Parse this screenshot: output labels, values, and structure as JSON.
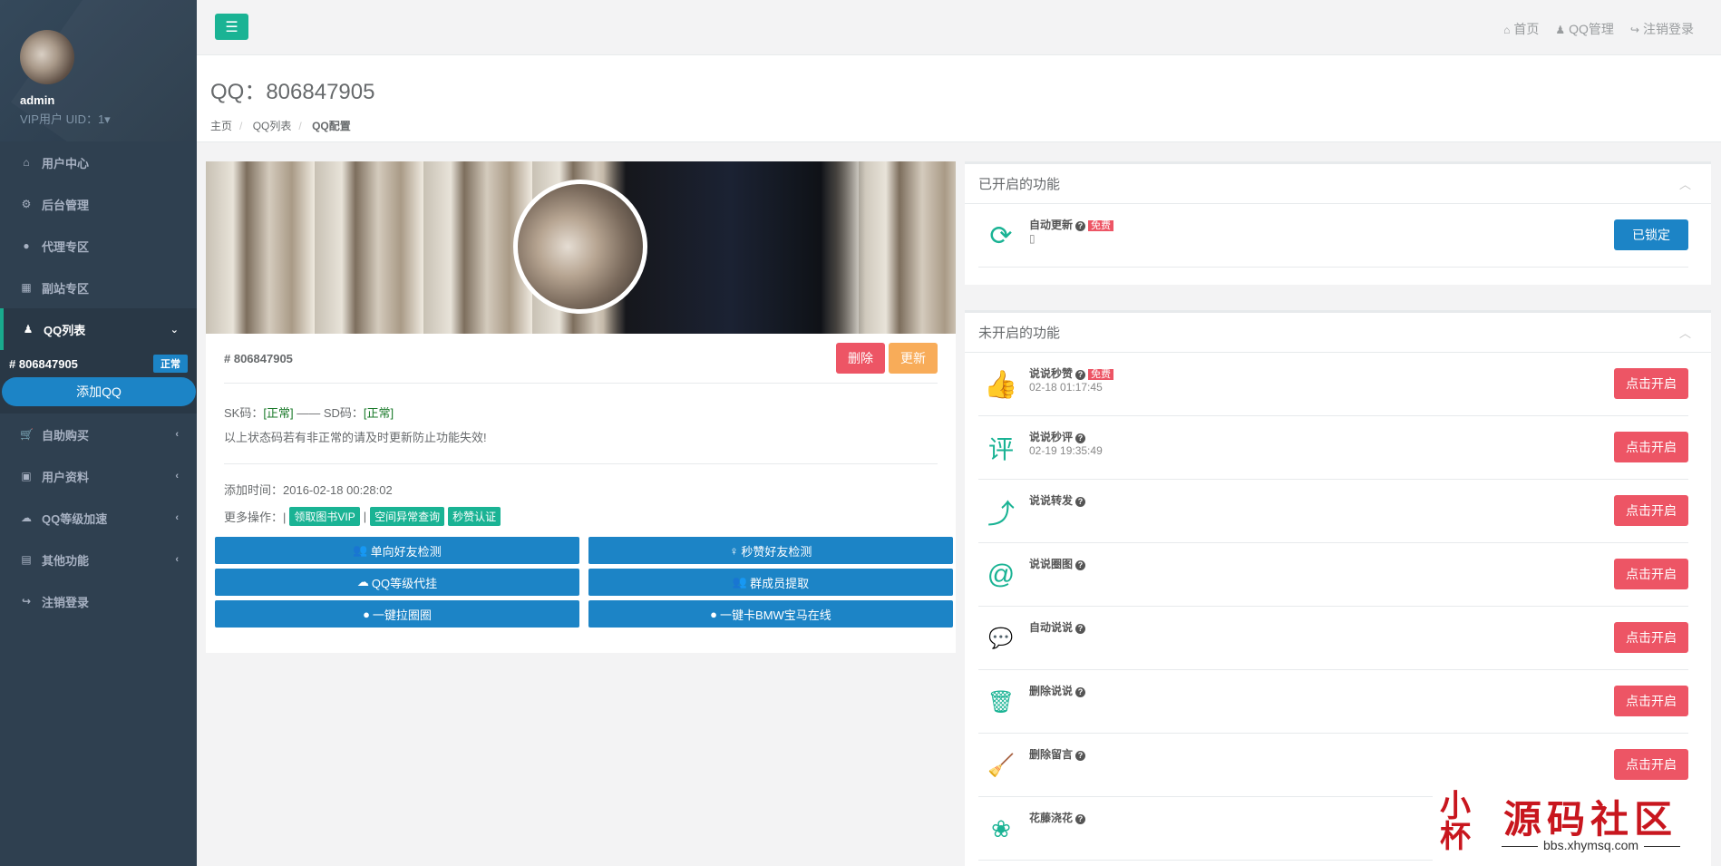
{
  "sidebar": {
    "user_name": "admin",
    "user_role": "VIP用户 UID：1▾",
    "menu": [
      {
        "label": "用户中心",
        "icon": "home-icon"
      },
      {
        "label": "后台管理",
        "icon": "gear-icon"
      },
      {
        "label": "代理专区",
        "icon": "globe-icon"
      },
      {
        "label": "副站专区",
        "icon": "grid-icon"
      },
      {
        "label": "QQ列表",
        "icon": "qq-icon"
      },
      {
        "label": "自助购买",
        "icon": "cart-icon"
      },
      {
        "label": "用户资料",
        "icon": "gift-icon"
      },
      {
        "label": "QQ等级加速",
        "icon": "cloud-icon"
      },
      {
        "label": "其他功能",
        "icon": "briefcase-icon"
      },
      {
        "label": "注销登录",
        "icon": "logout-icon"
      }
    ],
    "qq_sub": {
      "id": "# 806847905",
      "status": "正常",
      "add_label": "添加QQ"
    }
  },
  "topbar": {
    "links": [
      "首页",
      "QQ管理",
      "注销登录"
    ]
  },
  "header": {
    "title": "QQ：806847905",
    "breadcrumb": [
      "主页",
      "QQ列表",
      "QQ配置"
    ]
  },
  "profile": {
    "id": "# 806847905",
    "delete_label": "删除",
    "update_label": "更新",
    "sk_label": "SK码：",
    "sk_status": "[正常]",
    "dash": "—— SD码：",
    "sd_status": "[正常]",
    "note": "以上状态码若有非正常的请及时更新防止功能失效!",
    "add_time": "添加时间：2016-02-18 00:28:02",
    "more_label": "更多操作：|",
    "tags": [
      "领取图书VIP",
      "空间异常查询",
      "秒赞认证"
    ],
    "tag_sep": "|",
    "actions": [
      "单向好友检测",
      "秒赞好友检测",
      "QQ等级代挂",
      "群成员提取",
      "一键拉圈圈",
      "一键卡BMW宝马在线"
    ]
  },
  "enabled": {
    "title": "已开启的功能",
    "items": [
      {
        "name": "自动更新",
        "free": "免费",
        "time": "▯",
        "button": "已锁定",
        "icon": "refresh-icon"
      }
    ]
  },
  "disabled": {
    "title": "未开启的功能",
    "items": [
      {
        "name": "说说秒赞",
        "free": "免费",
        "time": "02-18 01:17:45",
        "button": "点击开启",
        "icon": "thumbs-up-icon"
      },
      {
        "name": "说说秒评",
        "free": "",
        "time": "02-19 19:35:49",
        "button": "点击开启",
        "icon": "comment-char-icon"
      },
      {
        "name": "说说转发",
        "free": "",
        "time": "",
        "button": "点击开启",
        "icon": "share-icon"
      },
      {
        "name": "说说圈图",
        "free": "",
        "time": "",
        "button": "点击开启",
        "icon": "at-icon"
      },
      {
        "name": "自动说说",
        "free": "",
        "time": "",
        "button": "点击开启",
        "icon": "chat-bubble-icon"
      },
      {
        "name": "删除说说",
        "free": "",
        "time": "",
        "button": "点击开启",
        "icon": "trash-icon"
      },
      {
        "name": "删除留言",
        "free": "",
        "time": "",
        "button": "点击开启",
        "icon": "broom-icon"
      },
      {
        "name": "花藤浇花",
        "free": "",
        "time": "",
        "button": "",
        "icon": "flower-icon"
      }
    ]
  },
  "watermark": {
    "logo": "小\n杯",
    "title": "源码社区",
    "url": "bbs.xhymsq.com"
  }
}
